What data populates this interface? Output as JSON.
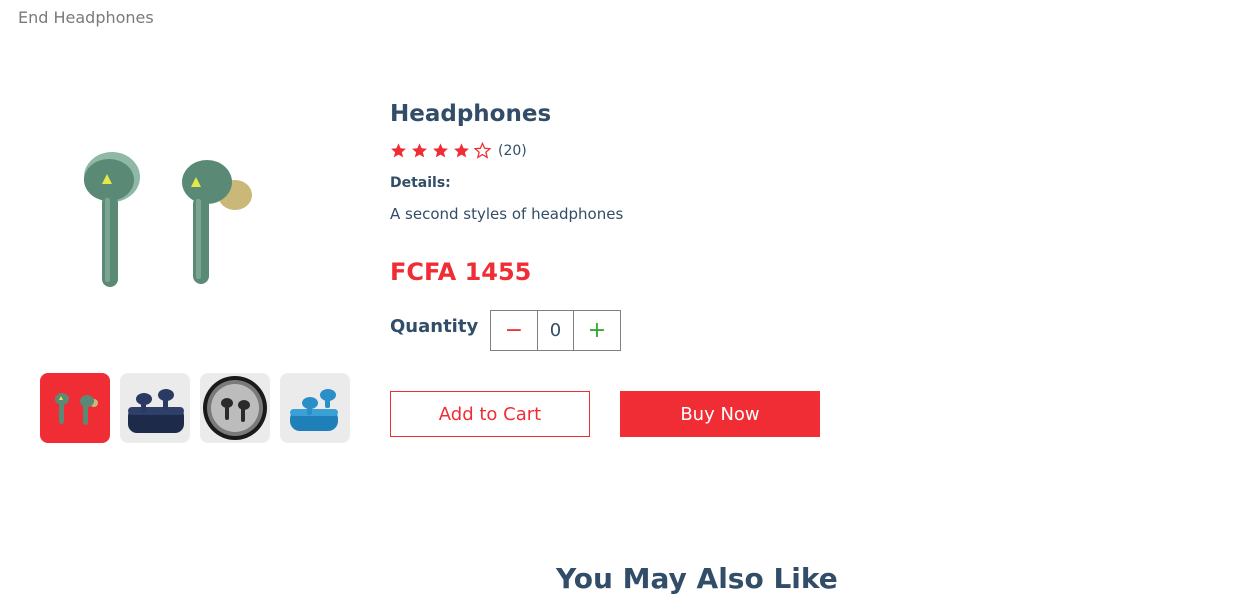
{
  "breadcrumb_text": "End Headphones",
  "product": {
    "name": "Headphones",
    "rating": 4,
    "rating_max": 5,
    "review_count": "(20)",
    "details_label": "Details:",
    "details": "A second styles of headphones",
    "price": "FCFA 1455"
  },
  "quantity": {
    "label": "Quantity",
    "value": "0",
    "minus_icon": "minus-icon",
    "plus_icon": "plus-icon"
  },
  "buttons": {
    "add_to_cart": "Add to Cart",
    "buy_now": "Buy Now"
  },
  "thumbnails": [
    {
      "name": "green-earbuds",
      "active": true
    },
    {
      "name": "navy-earbuds-case",
      "active": false
    },
    {
      "name": "black-earbuds-case",
      "active": false
    },
    {
      "name": "blue-earbuds-case",
      "active": false
    }
  ],
  "section_heading": "You May Also Like",
  "colors": {
    "accent": "#f02d34",
    "text": "#324d67",
    "plus": "#31a831"
  }
}
